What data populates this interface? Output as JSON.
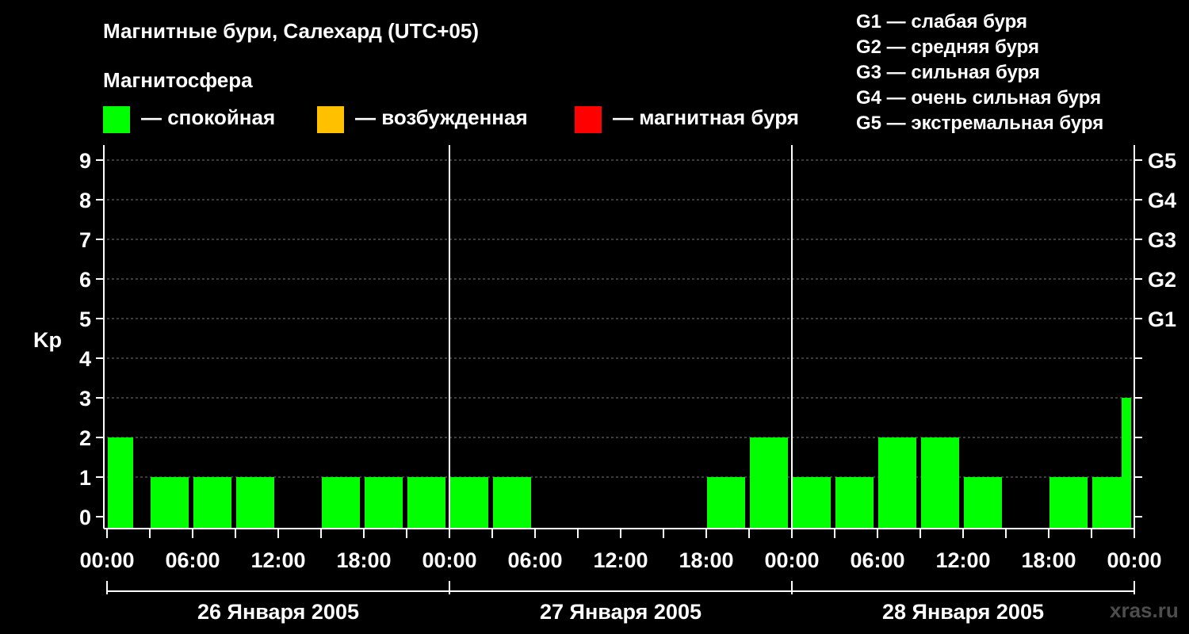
{
  "header": {
    "title": "Магнитные бури, Салехард (UTC+05)",
    "subtitle": "Магнитосфера"
  },
  "legend": [
    {
      "label": "— спокойная",
      "color": "#00ff00"
    },
    {
      "label": "— возбужденная",
      "color": "#ffc000"
    },
    {
      "label": "— магнитная буря",
      "color": "#ff0000"
    }
  ],
  "g_scale": [
    "G1 — слабая буря",
    "G2 — средняя буря",
    "G3 — сильная буря",
    "G4 — очень сильная буря",
    "G5 — экстремальная буря"
  ],
  "watermark": "xras.ru",
  "chart_data": {
    "type": "bar",
    "ylabel": "Kp",
    "ylim": [
      0,
      9
    ],
    "y_ticks": [
      "0",
      "1",
      "2",
      "3",
      "4",
      "5",
      "6",
      "7",
      "8",
      "9"
    ],
    "right_axis_labels": [
      {
        "y": 5,
        "label": "G1"
      },
      {
        "y": 6,
        "label": "G2"
      },
      {
        "y": 7,
        "label": "G3"
      },
      {
        "y": 8,
        "label": "G4"
      },
      {
        "y": 9,
        "label": "G5"
      }
    ],
    "x_tick_labels": [
      "00:00",
      "06:00",
      "12:00",
      "18:00",
      "00:00",
      "06:00",
      "12:00",
      "18:00",
      "00:00",
      "06:00",
      "12:00",
      "18:00",
      "00:00"
    ],
    "days": [
      "26 Января 2005",
      "27 Января 2005",
      "28 Января 2005"
    ],
    "grid": "dashed horizontal",
    "bar_color": "#00ff00",
    "kp_3h": [
      2,
      1,
      1,
      1,
      0,
      1,
      1,
      1,
      1,
      1,
      0,
      0,
      0,
      0,
      1,
      2,
      1,
      1,
      2,
      2,
      1,
      0,
      1,
      1,
      3
    ]
  }
}
